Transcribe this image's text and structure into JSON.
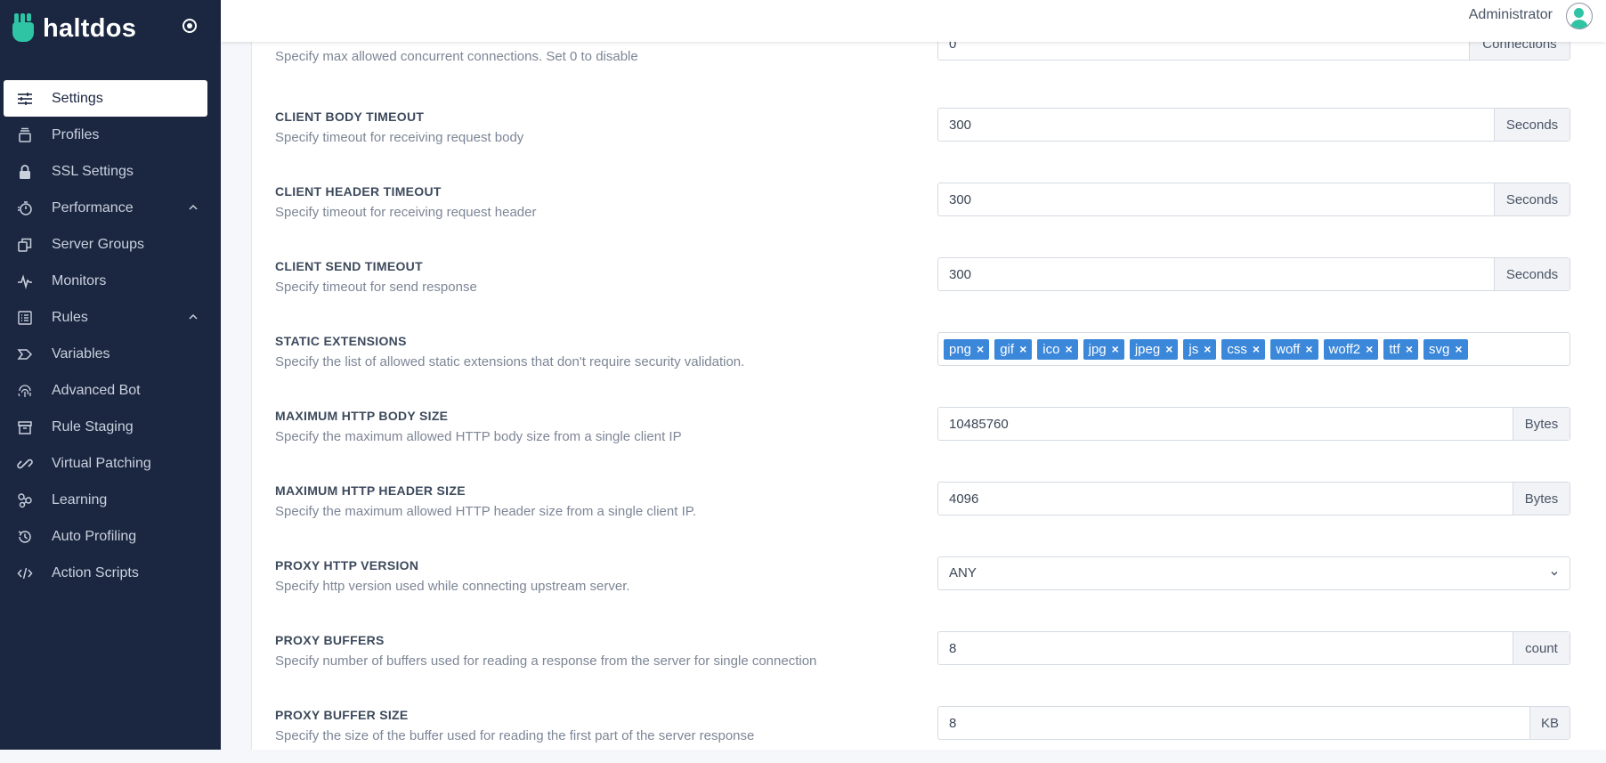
{
  "brand": {
    "name": "haltdos"
  },
  "sidebar": {
    "items": [
      {
        "label": "Settings",
        "icon": "sliders-icon",
        "active": true
      },
      {
        "label": "Profiles",
        "icon": "stack-icon"
      },
      {
        "label": "SSL Settings",
        "icon": "lock-icon"
      },
      {
        "label": "Performance",
        "icon": "stopwatch-icon",
        "expanded": true
      },
      {
        "label": "Server Groups",
        "icon": "copy-icon"
      },
      {
        "label": "Monitors",
        "icon": "pulse-icon"
      },
      {
        "label": "Rules",
        "icon": "list-icon",
        "expanded": true
      },
      {
        "label": "Variables",
        "icon": "tag-icon"
      },
      {
        "label": "Advanced Bot",
        "icon": "fingerprint-icon"
      },
      {
        "label": "Rule Staging",
        "icon": "archive-icon"
      },
      {
        "label": "Virtual Patching",
        "icon": "link-icon"
      },
      {
        "label": "Learning",
        "icon": "molecule-icon"
      },
      {
        "label": "Auto Profiling",
        "icon": "history-icon"
      },
      {
        "label": "Action Scripts",
        "icon": "code-icon"
      }
    ]
  },
  "header": {
    "user": "Administrator"
  },
  "settings": {
    "max_connections": {
      "desc": "Specify max allowed concurrent connections. Set 0 to disable",
      "value": "0",
      "unit": "Connections"
    },
    "client_body_timeout": {
      "title": "CLIENT BODY TIMEOUT",
      "desc": "Specify timeout for receiving request body",
      "value": "300",
      "unit": "Seconds"
    },
    "client_header_timeout": {
      "title": "CLIENT HEADER TIMEOUT",
      "desc": "Specify timeout for receiving request header",
      "value": "300",
      "unit": "Seconds"
    },
    "client_send_timeout": {
      "title": "CLIENT SEND TIMEOUT",
      "desc": "Specify timeout for send response",
      "value": "300",
      "unit": "Seconds"
    },
    "static_extensions": {
      "title": "STATIC EXTENSIONS",
      "desc": "Specify the list of allowed static extensions that don't require security validation.",
      "tags": [
        "png",
        "gif",
        "ico",
        "jpg",
        "jpeg",
        "js",
        "css",
        "woff",
        "woff2",
        "ttf",
        "svg"
      ]
    },
    "max_http_body_size": {
      "title": "MAXIMUM HTTP BODY SIZE",
      "desc": "Specify the maximum allowed HTTP body size from a single client IP",
      "value": "10485760",
      "unit": "Bytes"
    },
    "max_http_header_size": {
      "title": "MAXIMUM HTTP HEADER SIZE",
      "desc": "Specify the maximum allowed HTTP header size from a single client IP.",
      "value": "4096",
      "unit": "Bytes"
    },
    "proxy_http_version": {
      "title": "PROXY HTTP VERSION",
      "desc": "Specify http version used while connecting upstream server.",
      "value": "ANY"
    },
    "proxy_buffers": {
      "title": "PROXY BUFFERS",
      "desc": "Specify number of buffers used for reading a response from the server for single connection",
      "value": "8",
      "unit": "count"
    },
    "proxy_buffer_size": {
      "title": "PROXY BUFFER SIZE",
      "desc": "Specify the size of the buffer used for reading the first part of the server response",
      "value": "8",
      "unit": "KB"
    }
  }
}
